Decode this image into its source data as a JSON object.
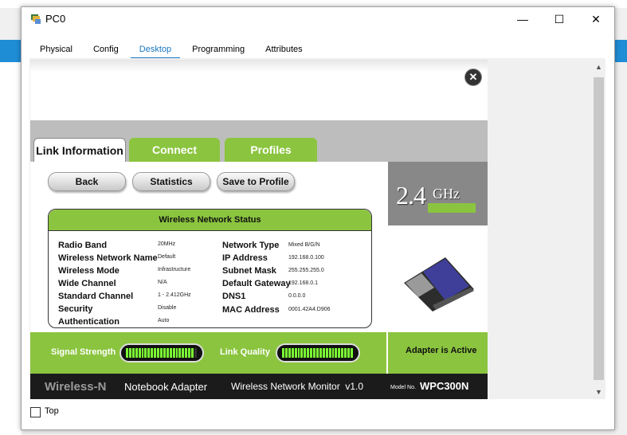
{
  "window": {
    "title": "PC0",
    "minimize": "—",
    "maximize": "☐",
    "close": "✕"
  },
  "tabs": [
    "Physical",
    "Config",
    "Desktop",
    "Programming",
    "Attributes"
  ],
  "active_tab": "Desktop",
  "app": {
    "close_icon": "close-icon",
    "tabs": [
      "Link Information",
      "Connect",
      "Profiles"
    ],
    "buttons": {
      "back": "Back",
      "statistics": "Statistics",
      "save": "Save to Profile"
    },
    "status_title": "Wireless Network Status",
    "left_labels": [
      "Radio Band",
      "Wireless Network Name",
      "Wireless Mode",
      "Wide Channel",
      "Standard Channel",
      "Security",
      "Authentication"
    ],
    "left_values": [
      "20MHz",
      "Default",
      "Infrastructure",
      "N/A",
      "1 - 2.412GHz",
      "Disable",
      "Auto"
    ],
    "right_labels": [
      "Network Type",
      "IP Address",
      "Subnet Mask",
      "Default Gateway",
      "DNS1",
      "MAC Address"
    ],
    "right_values": [
      "Mixed B/G/N",
      "192.168.0.100",
      "255.255.255.0",
      "192.168.0.1",
      "0.0.0.0",
      "0001.42A4.D906"
    ],
    "ghz_number": "2.4",
    "ghz_unit": "GHz",
    "signal_label": "Signal Strength",
    "link_label": "Link Quality",
    "signal_level": 0.95,
    "link_level": 1.0,
    "adapter_status": "Adapter is Active",
    "footer": {
      "brand": "Wireless-N",
      "product": "Notebook Adapter",
      "monitor": "Wireless Network Monitor  v1.0",
      "model_label": "Model No.",
      "model": "WPC300N"
    }
  },
  "top_checkbox": "Top",
  "colors": {
    "accent_green": "#8bc43f",
    "tab_blue": "#1a78c2"
  }
}
